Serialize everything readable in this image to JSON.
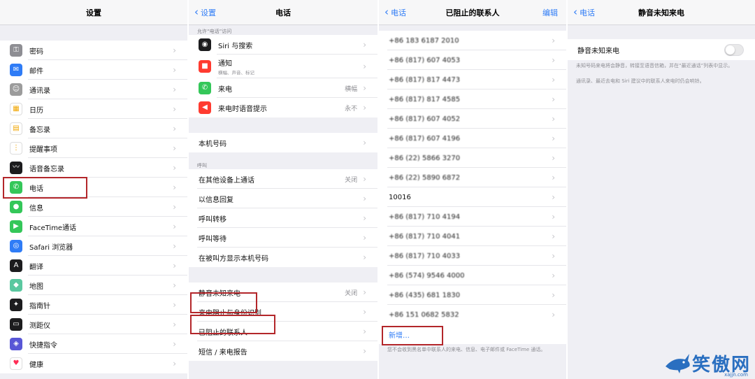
{
  "settings": {
    "title": "设置",
    "items": [
      {
        "label": "密码",
        "icon": "key-icon",
        "color": "#8e8e93"
      },
      {
        "label": "邮件",
        "icon": "mail-icon",
        "color": "#2f7cf6"
      },
      {
        "label": "通讯录",
        "icon": "contacts-icon",
        "color": "#9c9c9c"
      },
      {
        "label": "日历",
        "icon": "calendar-icon",
        "color": "#ffffff"
      },
      {
        "label": "备忘录",
        "icon": "notes-icon",
        "color": "#ffffff"
      },
      {
        "label": "提醒事项",
        "icon": "reminders-icon",
        "color": "#ffffff"
      },
      {
        "label": "语音备忘录",
        "icon": "voice-memos-icon",
        "color": "#1c1c1e"
      },
      {
        "label": "电话",
        "icon": "phone-icon",
        "color": "#34c759"
      },
      {
        "label": "信息",
        "icon": "messages-icon",
        "color": "#34c759"
      },
      {
        "label": "FaceTime通话",
        "icon": "facetime-icon",
        "color": "#34c759"
      },
      {
        "label": "Safari 浏览器",
        "icon": "safari-icon",
        "color": "#2f7cf6"
      },
      {
        "label": "翻译",
        "icon": "translate-icon",
        "color": "#1c1c1e"
      },
      {
        "label": "地图",
        "icon": "maps-icon",
        "color": "#5ac8a0"
      },
      {
        "label": "指南针",
        "icon": "compass-icon",
        "color": "#1c1c1e"
      },
      {
        "label": "测距仪",
        "icon": "measure-icon",
        "color": "#1c1c1e"
      },
      {
        "label": "快捷指令",
        "icon": "shortcuts-icon",
        "color": "#5856d6"
      },
      {
        "label": "健康",
        "icon": "health-icon",
        "color": "#ffffff"
      }
    ]
  },
  "phone": {
    "back": "设置",
    "title": "电话",
    "allow_header": "允许“电话”访问",
    "access_items": [
      {
        "label": "Siri 与搜索",
        "icon": "siri-icon",
        "color": "#1c1c1e",
        "value": ""
      },
      {
        "label": "通知",
        "sub": "横幅、声音、标记",
        "icon": "notifications-icon",
        "color": "#ff3b30",
        "value": ""
      },
      {
        "label": "来电",
        "icon": "phone-icon",
        "color": "#34c759",
        "value": "横幅"
      },
      {
        "label": "来电时语音提示",
        "icon": "speaker-icon",
        "color": "#ff3b30",
        "value": "永不"
      }
    ],
    "my_number": "本机号码",
    "calls_header": "呼叫",
    "call_items": [
      {
        "label": "在其他设备上通话",
        "value": "关闭"
      },
      {
        "label": "以信息回复",
        "value": ""
      },
      {
        "label": "呼叫转移",
        "value": ""
      },
      {
        "label": "呼叫等待",
        "value": ""
      },
      {
        "label": "在被叫方显示本机号码",
        "value": ""
      }
    ],
    "block_items": [
      {
        "label": "静音未知来电",
        "value": "关闭"
      },
      {
        "label": "来电阻止与身份识别",
        "value": ""
      },
      {
        "label": "已阻止的联系人",
        "value": ""
      },
      {
        "label": "短信 / 来电报告",
        "value": ""
      }
    ]
  },
  "blocked": {
    "back": "电话",
    "title": "已阻止的联系人",
    "edit": "编辑",
    "numbers": [
      "+86 183 6187 2010",
      "+86 (817) 607 4053",
      "+86 (817) 817 4473",
      "+86 (817) 817 4585",
      "+86 (817) 607 4052",
      "+86 (817) 607 4196",
      "+86 (22) 5866 3270",
      "+86 (22) 5890 6872",
      "10016",
      "+86 (817) 710 4194",
      "+86 (817) 710 4041",
      "+86 (817) 710 4033",
      "+86 (574) 9546 4000",
      "+86 (435) 681 1830",
      "+86 151 0682 5832"
    ],
    "add_new": "新增…",
    "footer": "您不会收到黑名单中联系人的来电、信息、电子邮件或 FaceTime 通话。"
  },
  "silence": {
    "back": "电话",
    "title": "静音未知来电",
    "toggle_label": "静音未知来电",
    "toggle_on": false,
    "note1": "未知号码来电将会静音，转接至语音信箱，并在“最近通话”列表中显示。",
    "note2": "通讯录、最近去电和 Siri 建议中的联系人来电时仍会响铃。"
  },
  "watermark": {
    "text": "笑傲网",
    "url": "xajjn.com"
  },
  "colors": {
    "accent": "#2f7cf6",
    "highlight": "#b3262a",
    "background": "#efeff4"
  }
}
